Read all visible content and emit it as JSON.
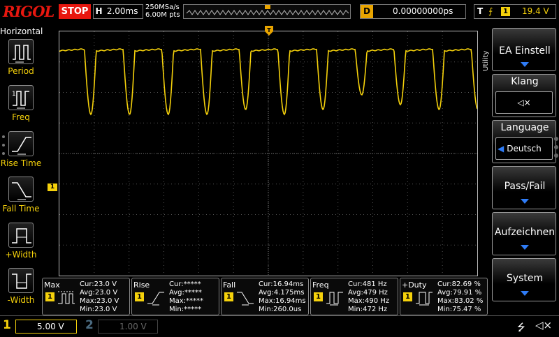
{
  "topbar": {
    "logo": "RIGOL",
    "run_state": "STOP",
    "timebase_label": "H",
    "timebase_value": "2.00ms",
    "sample_rate": "250MSa/s",
    "memory_depth": "6.00M pts",
    "delay_label": "D",
    "delay_value": "0.00000000ps",
    "trigger_label": "T",
    "trigger_slope": "⨍",
    "trigger_channel": "1",
    "trigger_level": "19.4 V"
  },
  "left_panel": {
    "title": "Horizontal",
    "items": [
      {
        "label": "Period"
      },
      {
        "label": "Freq"
      },
      {
        "label": "Rise Time"
      },
      {
        "label": "Fall Time"
      },
      {
        "label": "+Width"
      },
      {
        "label": "-Width"
      }
    ]
  },
  "channel_marker": "1",
  "right_menu": {
    "utility_label": "Utility",
    "buttons": [
      {
        "label": "EA Einstell"
      },
      {
        "label": "Klang",
        "value": "◁×"
      },
      {
        "label": "Language",
        "value": "Deutsch"
      },
      {
        "label": "Pass/Fail"
      },
      {
        "label": "Aufzeichnen"
      },
      {
        "label": "System"
      }
    ]
  },
  "readouts": [
    {
      "name": "Max",
      "channel": "1",
      "cur": "Cur:23.0 V",
      "avg": "Avg:23.0 V",
      "max": "Max:23.0 V",
      "min": "Min:23.0 V"
    },
    {
      "name": "Rise",
      "channel": "1",
      "cur": "Cur:*****",
      "avg": "Avg:*****",
      "max": "Max:*****",
      "min": "Min:*****"
    },
    {
      "name": "Fall",
      "channel": "1",
      "cur": "Cur:16.94ms",
      "avg": "Avg:4.175ms",
      "max": "Max:16.94ms",
      "min": "Min:260.0us"
    },
    {
      "name": "Freq",
      "channel": "1",
      "cur": "Cur:481 Hz",
      "avg": "Avg:479 Hz",
      "max": "Max:490 Hz",
      "min": "Min:472 Hz"
    },
    {
      "name": "+Duty",
      "channel": "1",
      "cur": "Cur:82.69 %",
      "avg": "Avg:79.91 %",
      "max": "Max:83.02 %",
      "min": "Min:75.47 %"
    }
  ],
  "bottombar": {
    "ch1_number": "1",
    "ch1_scale": "5.00 V",
    "ch2_number": "2",
    "ch2_scale": "1.00 V",
    "usb_icon": "⭍",
    "speaker_icon": "◁×"
  },
  "colors": {
    "ch1": "#f5d10b",
    "accent_red": "#e8170f",
    "delay_orange": "#e8a400",
    "menu_arrow": "#2f7cf6"
  },
  "waveform": {
    "cycles": 11,
    "high_level": 0.92,
    "dip_depths": [
      0.26,
      0.26,
      0.26,
      0.26,
      0.26,
      0.24,
      0.26,
      0.24,
      0.18,
      0.22,
      0.24
    ]
  }
}
